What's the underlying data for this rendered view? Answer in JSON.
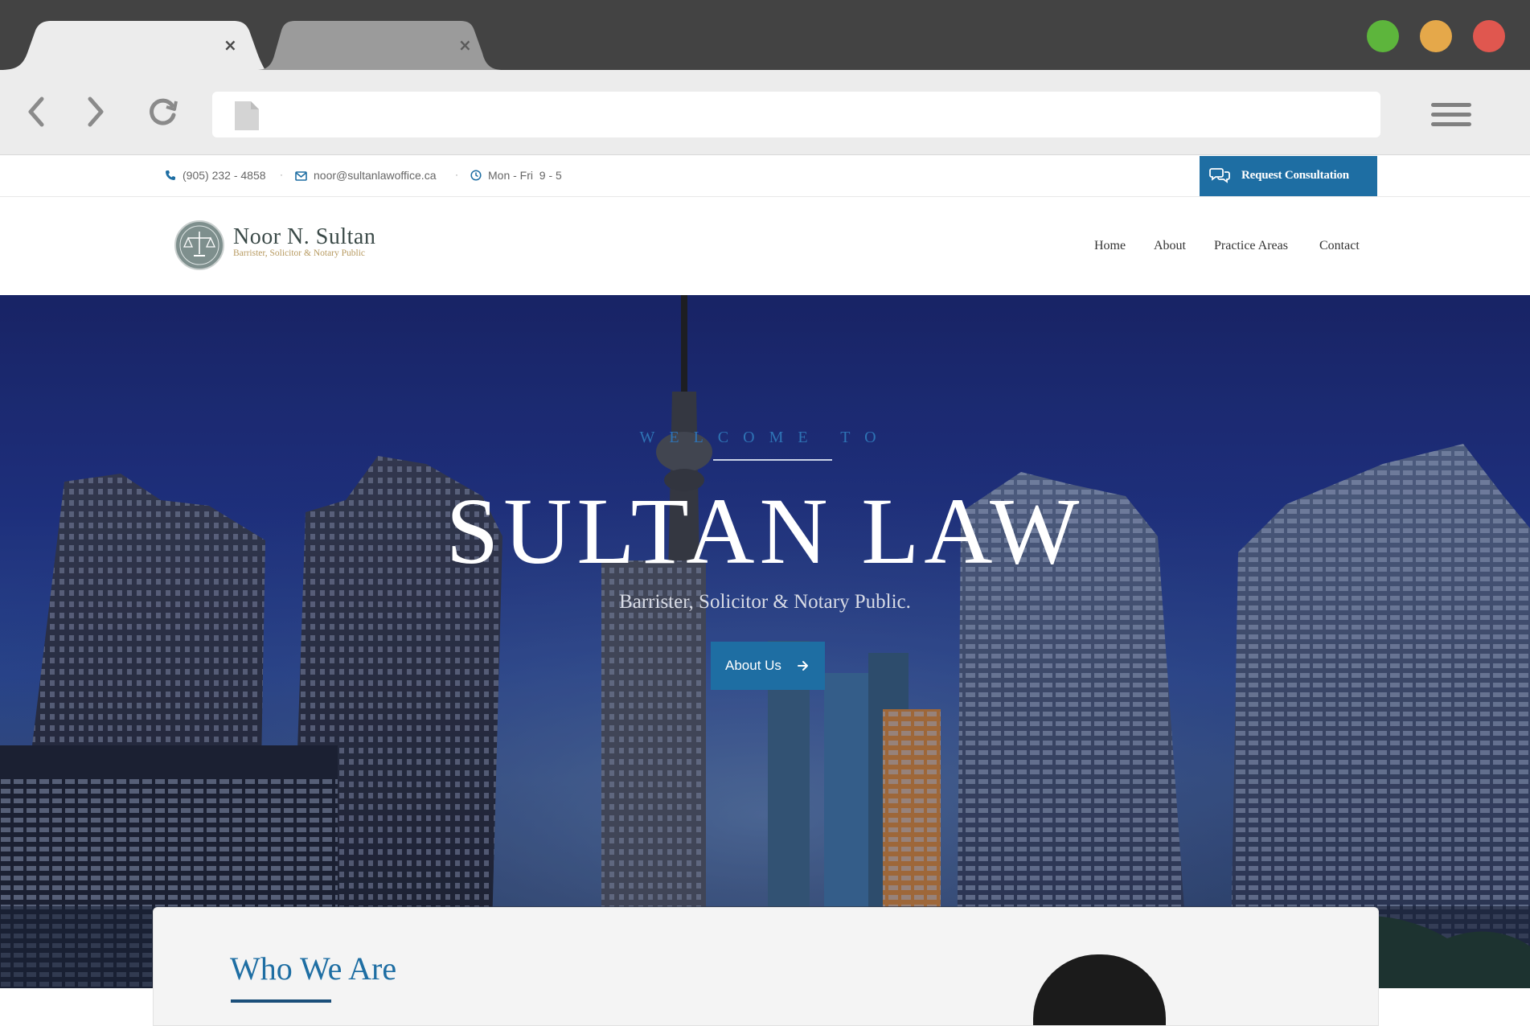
{
  "browser": {
    "tabs": [
      {
        "title": "",
        "close_glyph": "×",
        "active": true
      },
      {
        "title": "",
        "close_glyph": "×",
        "active": false
      }
    ],
    "window_controls": {
      "green": "#5db53c",
      "yellow": "#e5a84a",
      "red": "#e0574f"
    },
    "address": ""
  },
  "topbar": {
    "phone": "(905) 232 - 4858",
    "email": "noor@sultanlawoffice.ca",
    "hours": "Mon - Fri  9 - 5",
    "separator": "·",
    "consult_label": "Request Consultation"
  },
  "header": {
    "logo_name": "Noor N. Sultan",
    "logo_tagline": "Barrister, Solicitor & Notary Public",
    "nav": [
      "Home",
      "About",
      "Practice Areas",
      "Contact"
    ]
  },
  "hero": {
    "kicker": "WELCOME TO",
    "title": "SULTAN LAW",
    "subtitle": "Barrister, Solicitor & Notary Public.",
    "cta_label": "About Us"
  },
  "section": {
    "title": "Who We Are"
  },
  "colors": {
    "accent": "#1e6ea3",
    "chrome_dark": "#434343",
    "chrome_light": "#ececec"
  }
}
